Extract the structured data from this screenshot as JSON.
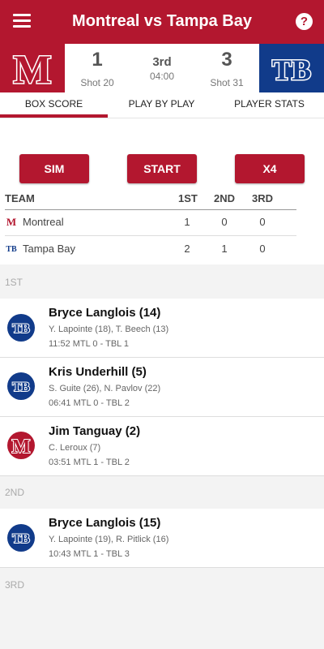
{
  "app_bar": {
    "title": "Montreal vs Tampa Bay",
    "help_icon": "?"
  },
  "scoreboard": {
    "home": {
      "logo_text": "M",
      "score": "1",
      "shots": "Shot 20",
      "color": "#b3172f"
    },
    "away": {
      "logo_text": "TB",
      "score": "3",
      "shots": "Shot 31",
      "color": "#113b8a"
    },
    "period": "3rd",
    "clock": "04:00"
  },
  "tabs": [
    {
      "label": "BOX SCORE",
      "active": true
    },
    {
      "label": "PLAY BY PLAY",
      "active": false
    },
    {
      "label": "PLAYER STATS",
      "active": false
    }
  ],
  "controls": {
    "sim": "SIM",
    "start": "START",
    "x4": "X4"
  },
  "box_score": {
    "headers": [
      "TEAM",
      "1ST",
      "2ND",
      "3RD"
    ],
    "rows": [
      {
        "team": "Montreal",
        "logo": "M",
        "p1": "1",
        "p2": "0",
        "p3": "0"
      },
      {
        "team": "Tampa Bay",
        "logo": "TB",
        "p1": "2",
        "p2": "1",
        "p3": "0"
      }
    ]
  },
  "periods": [
    {
      "label": "1ST"
    },
    {
      "label": "2ND"
    },
    {
      "label": "3RD"
    }
  ],
  "goals": [
    {
      "team_logo": "TB",
      "scorer": "Bryce Langlois (14)",
      "assists": "Y. Lapointe (18), T. Beech (13)",
      "time": "11:52 MTL 0 - TBL 1"
    },
    {
      "team_logo": "TB",
      "scorer": "Kris Underhill (5)",
      "assists": "S. Guite (26), N. Pavlov (22)",
      "time": "06:41 MTL 0 - TBL 2"
    },
    {
      "team_logo": "M",
      "scorer": "Jim Tanguay (2)",
      "assists": "C. Leroux (7)",
      "time": "03:51 MTL 1 - TBL 2"
    },
    {
      "team_logo": "TB",
      "scorer": "Bryce Langlois (15)",
      "assists": "Y. Lapointe (19), R. Pitlick (16)",
      "time": "10:43 MTL 1 - TBL 3"
    }
  ],
  "colors": {
    "accent": "#b3172f",
    "away": "#113b8a"
  }
}
